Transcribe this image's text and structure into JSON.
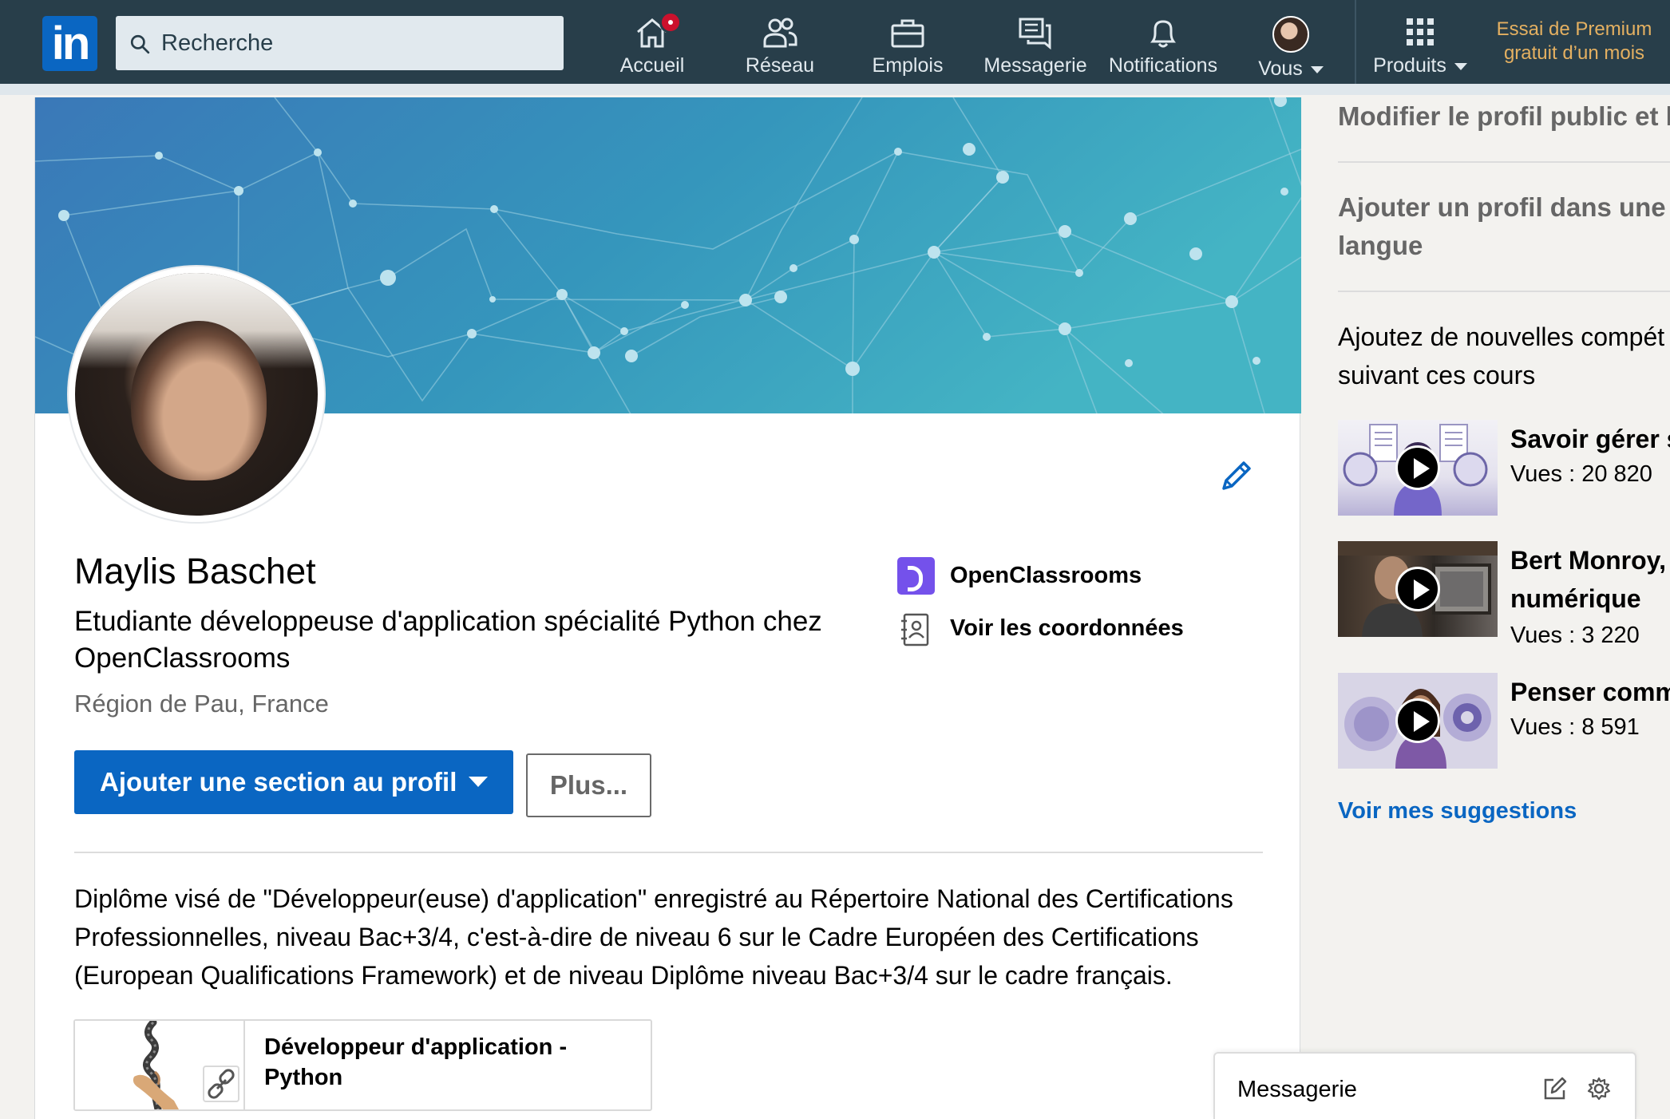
{
  "nav": {
    "search_placeholder": "Recherche",
    "items": [
      {
        "label": "Accueil",
        "icon": "home-icon"
      },
      {
        "label": "Réseau",
        "icon": "network-icon"
      },
      {
        "label": "Emplois",
        "icon": "briefcase-icon"
      },
      {
        "label": "Messagerie",
        "icon": "messaging-icon"
      },
      {
        "label": "Notifications",
        "icon": "bell-icon"
      },
      {
        "label": "Vous",
        "icon": "avatar"
      },
      {
        "label": "Produits",
        "icon": "grid-icon"
      }
    ],
    "premium_line1": "Essai de Premium",
    "premium_line2": "gratuit d’un mois",
    "colors": {
      "bar": "#283e4a",
      "accent": "#0a66c2",
      "premium": "#e4b061",
      "badge": "#cb112d"
    }
  },
  "profile": {
    "name": "Maylis Baschet",
    "headline": "Etudiante développeuse d'application spécialité Python chez OpenClassrooms",
    "location": "Région de Pau, France",
    "organization": "OpenClassrooms",
    "contact_label": "Voir les coordonnées",
    "add_section_label": "Ajouter une section au profil",
    "more_label": "Plus...",
    "summary": "Diplôme visé de \"Développeur(euse) d'application\" enregistré au Répertoire National des Certifications Professionnelles, niveau Bac+3/4, c'est-à-dire de niveau 6 sur le Cadre Européen des Certifications (European Qualifications Framework) et de niveau Diplôme niveau Bac+3/4 sur le cadre français.",
    "media_title": "Développeur d'application - Python"
  },
  "rail": {
    "edit_public_profile": "Modifier le profil public et l’U",
    "add_language_profile_line1": "Ajouter un profil dans une a",
    "add_language_profile_line2": "langue",
    "skills_prompt_line1": "Ajoutez de nouvelles compét",
    "skills_prompt_line2": "suivant ces cours",
    "courses": [
      {
        "title_line1": "Savoir gérer s",
        "title_line2": "",
        "views": "Vues : 20 820"
      },
      {
        "title_line1": "Bert Monroy,",
        "title_line2": "numérique",
        "views": "Vues : 3 220"
      },
      {
        "title_line1": "Penser comm",
        "title_line2": "",
        "views": "Vues : 8 591"
      }
    ],
    "suggestions_label": "Voir mes suggestions"
  },
  "messaging": {
    "title": "Messagerie"
  }
}
